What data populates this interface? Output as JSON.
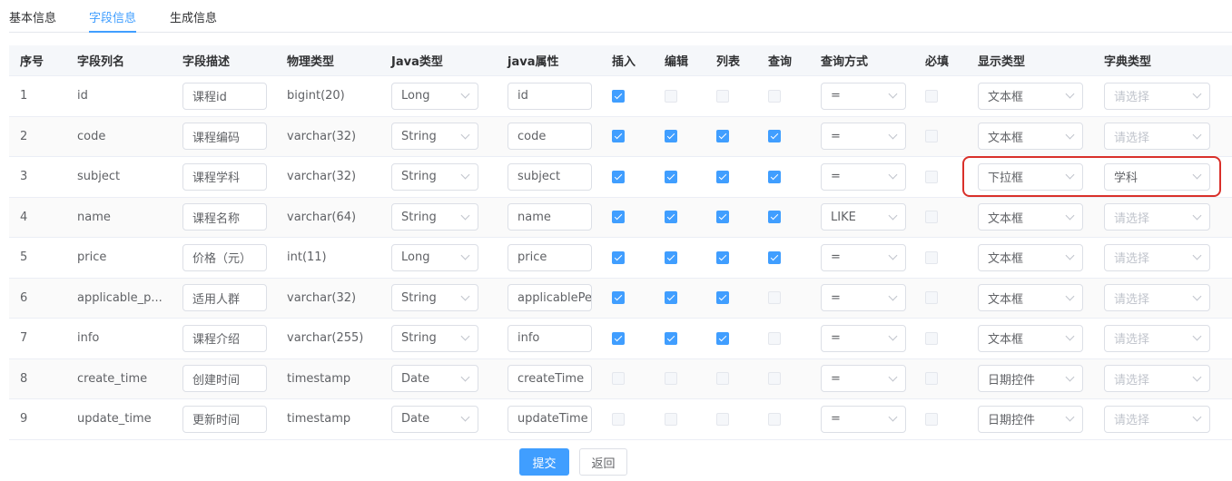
{
  "tabs": [
    "基本信息",
    "字段信息",
    "生成信息"
  ],
  "active_tab": 1,
  "columns": [
    "序号",
    "字段列名",
    "字段描述",
    "物理类型",
    "Java类型",
    "java属性",
    "插入",
    "编辑",
    "列表",
    "查询",
    "查询方式",
    "必填",
    "显示类型",
    "字典类型"
  ],
  "dict_placeholder": "请选择",
  "rows": [
    {
      "seq": "1",
      "column": "id",
      "desc": "课程id",
      "physical": "bigint(20)",
      "java_type": "Long",
      "java_attr": "id",
      "insert": true,
      "edit": false,
      "list": false,
      "query": false,
      "query_type": "=",
      "required": false,
      "display": "文本框",
      "dict": ""
    },
    {
      "seq": "2",
      "column": "code",
      "desc": "课程编码",
      "physical": "varchar(32)",
      "java_type": "String",
      "java_attr": "code",
      "insert": true,
      "edit": true,
      "list": true,
      "query": true,
      "query_type": "=",
      "required": false,
      "display": "文本框",
      "dict": ""
    },
    {
      "seq": "3",
      "column": "subject",
      "desc": "课程学科",
      "physical": "varchar(32)",
      "java_type": "String",
      "java_attr": "subject",
      "insert": true,
      "edit": true,
      "list": true,
      "query": true,
      "query_type": "=",
      "required": false,
      "display": "下拉框",
      "dict": "学科"
    },
    {
      "seq": "4",
      "column": "name",
      "desc": "课程名称",
      "physical": "varchar(64)",
      "java_type": "String",
      "java_attr": "name",
      "insert": true,
      "edit": true,
      "list": true,
      "query": true,
      "query_type": "LIKE",
      "required": false,
      "display": "文本框",
      "dict": ""
    },
    {
      "seq": "5",
      "column": "price",
      "desc": "价格（元）",
      "physical": "int(11)",
      "java_type": "Long",
      "java_attr": "price",
      "insert": true,
      "edit": true,
      "list": true,
      "query": true,
      "query_type": "=",
      "required": false,
      "display": "文本框",
      "dict": ""
    },
    {
      "seq": "6",
      "column": "applicable_p...",
      "desc": "适用人群",
      "physical": "varchar(32)",
      "java_type": "String",
      "java_attr": "applicablePe",
      "insert": true,
      "edit": true,
      "list": true,
      "query": false,
      "query_type": "=",
      "required": false,
      "display": "文本框",
      "dict": ""
    },
    {
      "seq": "7",
      "column": "info",
      "desc": "课程介绍",
      "physical": "varchar(255)",
      "java_type": "String",
      "java_attr": "info",
      "insert": true,
      "edit": true,
      "list": true,
      "query": false,
      "query_type": "=",
      "required": false,
      "display": "文本框",
      "dict": ""
    },
    {
      "seq": "8",
      "column": "create_time",
      "desc": "创建时间",
      "physical": "timestamp",
      "java_type": "Date",
      "java_attr": "createTime",
      "insert": false,
      "edit": false,
      "list": false,
      "query": false,
      "query_type": "=",
      "required": false,
      "display": "日期控件",
      "dict": ""
    },
    {
      "seq": "9",
      "column": "update_time",
      "desc": "更新时间",
      "physical": "timestamp",
      "java_type": "Date",
      "java_attr": "updateTime",
      "insert": false,
      "edit": false,
      "list": false,
      "query": false,
      "query_type": "=",
      "required": false,
      "display": "日期控件",
      "dict": ""
    }
  ],
  "buttons": {
    "submit": "提交",
    "back": "返回"
  },
  "colors": {
    "primary": "#409eff",
    "highlight": "#d9302a"
  }
}
